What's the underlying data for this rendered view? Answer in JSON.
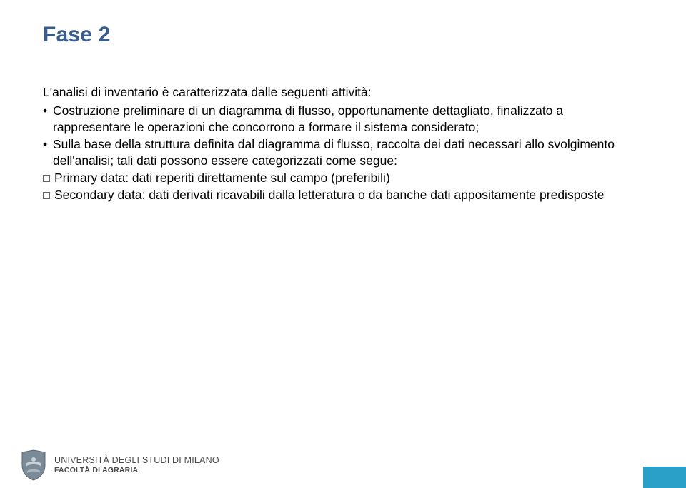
{
  "title": "Fase 2",
  "intro": "L'analisi di inventario è caratterizzata dalle seguenti attività:",
  "bullets": [
    "Costruzione preliminare di un diagramma di flusso, opportunamente dettagliato, finalizzato a rappresentare le operazioni che concorrono a formare il sistema considerato;",
    "Sulla base della struttura definita dal diagramma di flusso, raccolta dei dati necessari allo svolgimento dell'analisi; tali dati possono essere categorizzati come segue:"
  ],
  "sublines": [
    "Primary data: dati reperiti direttamente sul campo (preferibili)",
    "Secondary data: dati derivati ricavabili dalla letteratura o da banche dati appositamente predisposte"
  ],
  "footer": {
    "line1": "UNIVERSITÀ DEGLI STUDI DI MILANO",
    "line2": "FACOLTÀ DI AGRARIA"
  }
}
